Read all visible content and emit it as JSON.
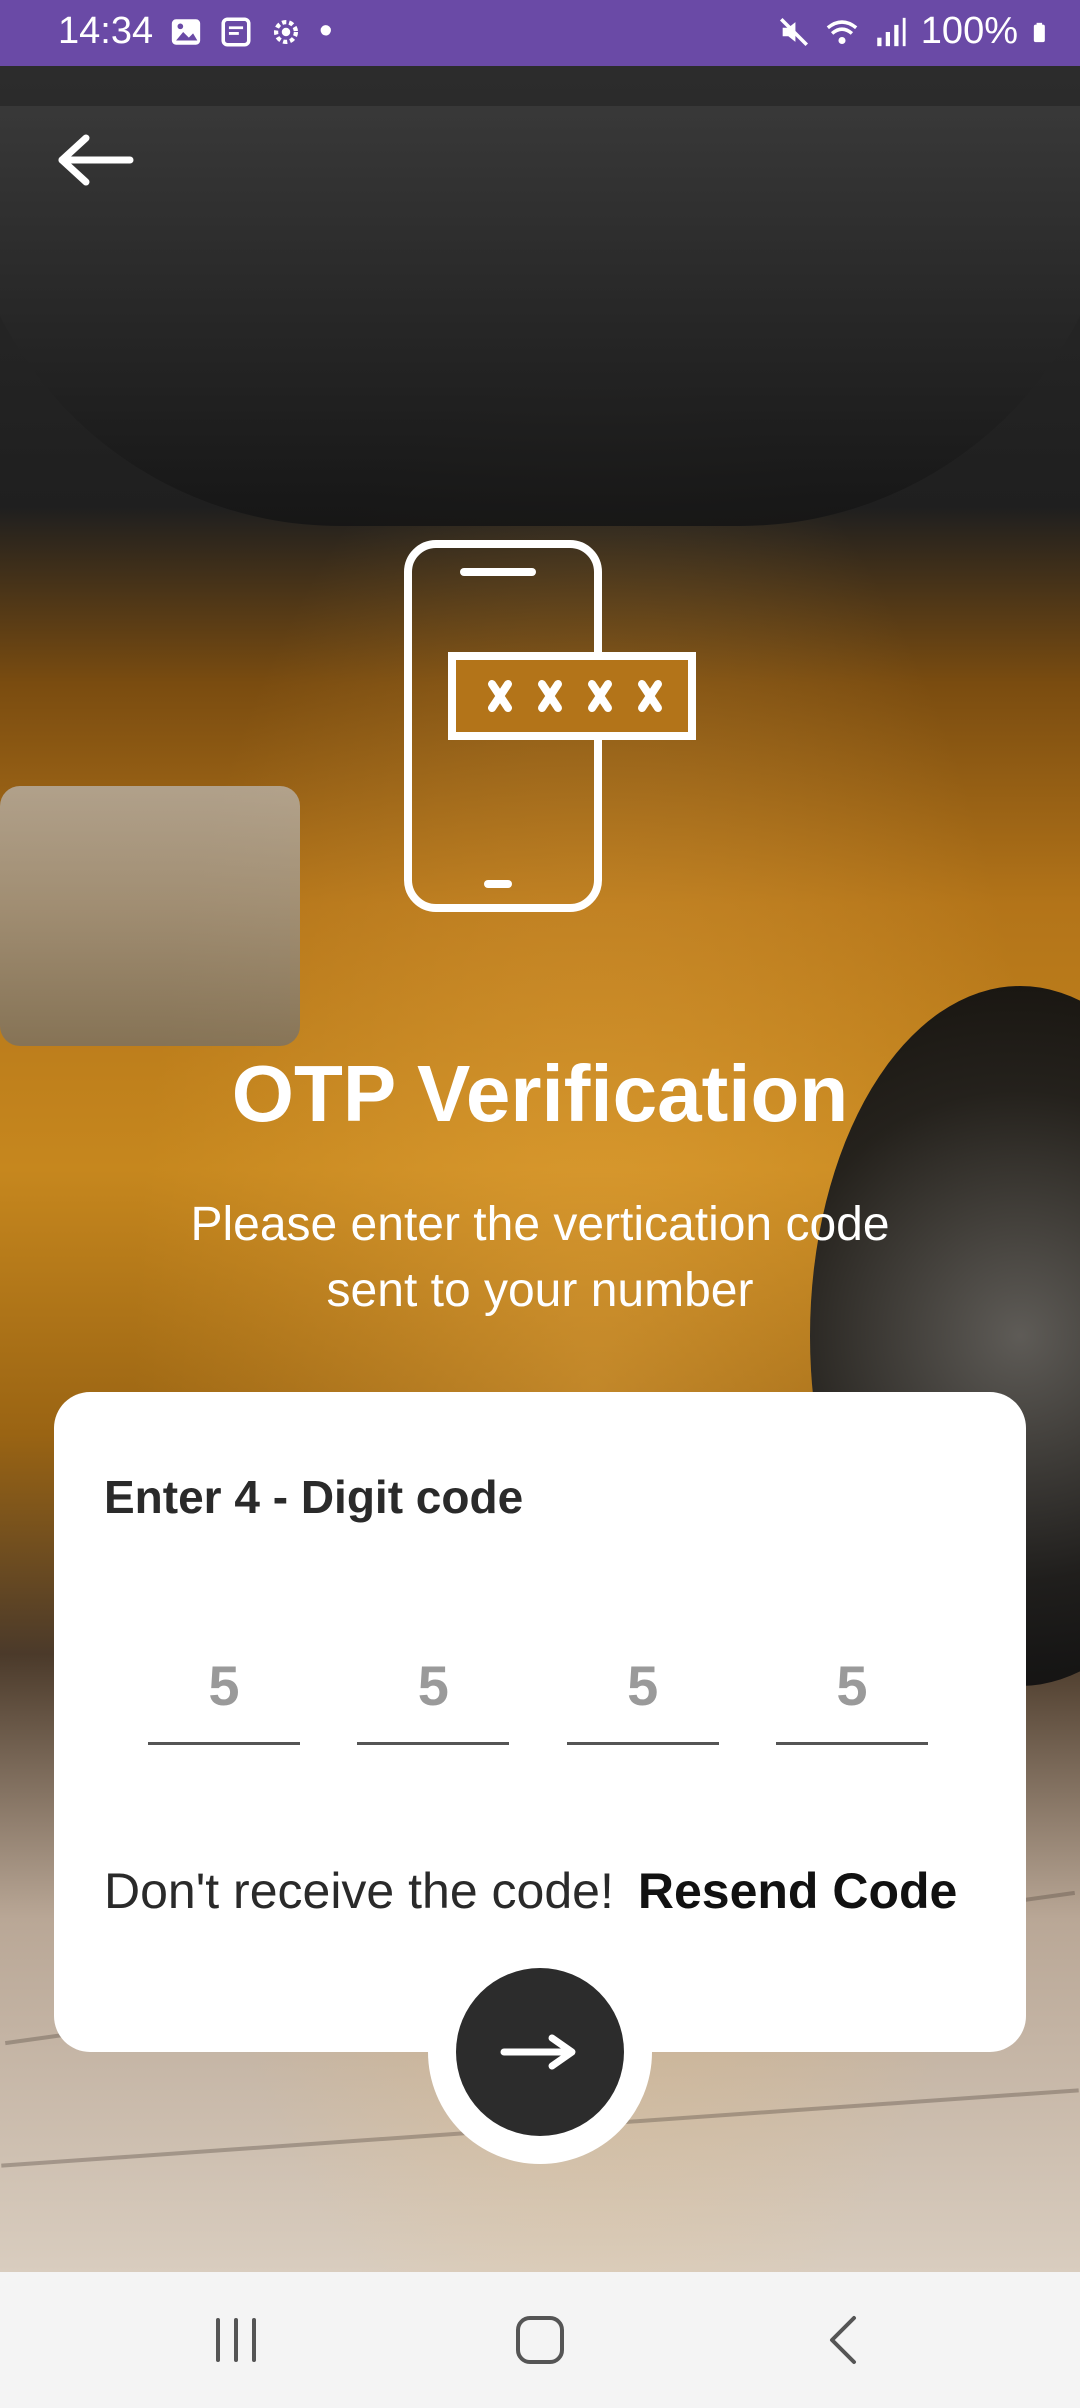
{
  "status_bar": {
    "time": "14:34",
    "dot": "•",
    "battery": "100%",
    "icons_left": [
      "image-icon",
      "notes-icon",
      "gear-icon"
    ],
    "icons_right": [
      "mute-icon",
      "wifi-icon",
      "signal-icon",
      "battery-icon"
    ]
  },
  "header": {
    "back_icon": "arrow-left-icon"
  },
  "hero": {
    "title": "OTP Verification",
    "subtitle": "Please enter the vertication code sent to your number"
  },
  "card": {
    "heading": "Enter 4 - Digit code",
    "otp_digits": [
      "5",
      "5",
      "5",
      "5"
    ],
    "resend_prompt": "Don't receive the code!",
    "resend_link": "Resend Code"
  },
  "submit": {
    "icon": "arrow-right-icon"
  },
  "nav": {
    "items": [
      "recent-apps-icon",
      "home-icon",
      "back-icon"
    ]
  }
}
